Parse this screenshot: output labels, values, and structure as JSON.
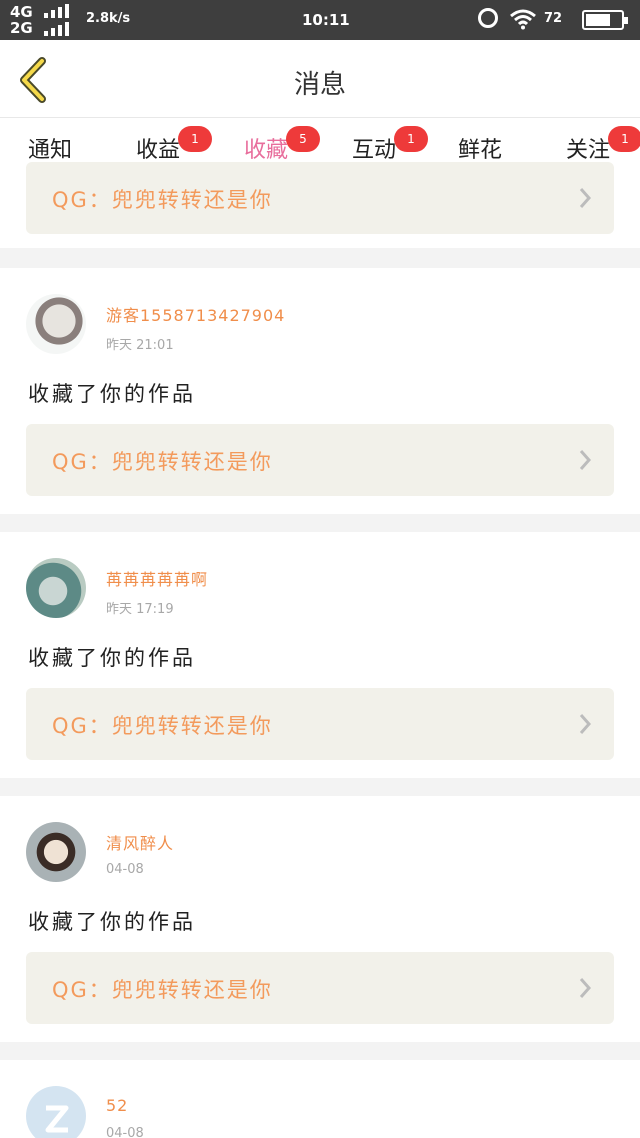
{
  "status_bar": {
    "net_top": "4G",
    "net_bottom": "2G",
    "speed": "2.8k/s",
    "time": "10:11",
    "battery_text": "72",
    "battery_level": 0.72,
    "icons": [
      "signal-icon",
      "alarm-icon",
      "wifi-icon",
      "battery-icon"
    ]
  },
  "header": {
    "title": "消息",
    "back_icon": "chevron-left-icon",
    "accent_color": "#e86e9c"
  },
  "tabs": [
    {
      "label": "通知",
      "badge": ""
    },
    {
      "label": "收益",
      "badge": "1"
    },
    {
      "label": "收藏",
      "badge": "5",
      "active": true
    },
    {
      "label": "互动",
      "badge": "1"
    },
    {
      "label": "鲜花",
      "badge": ""
    },
    {
      "label": "关注",
      "badge": "1"
    }
  ],
  "feed": {
    "first_quote": "QG：兜兜转转还是你",
    "items": [
      {
        "user": "游客1558713427904",
        "time": "昨天 21:01",
        "action": "收藏了你的作品",
        "quote": "QG：兜兜转转还是你"
      },
      {
        "user": "苒苒苒苒苒啊",
        "time": "昨天 17:19",
        "action": "收藏了你的作品",
        "quote": "QG：兜兜转转还是你"
      },
      {
        "user": "清风醉人",
        "time": "04-08",
        "action": "收藏了你的作品",
        "quote": "QG：兜兜转转还是你"
      },
      {
        "user": "52",
        "time": "04-08"
      }
    ]
  },
  "colors": {
    "username": "#f08e4b",
    "quote_bg": "#f2f1ea",
    "badge": "#ee3a3a"
  }
}
